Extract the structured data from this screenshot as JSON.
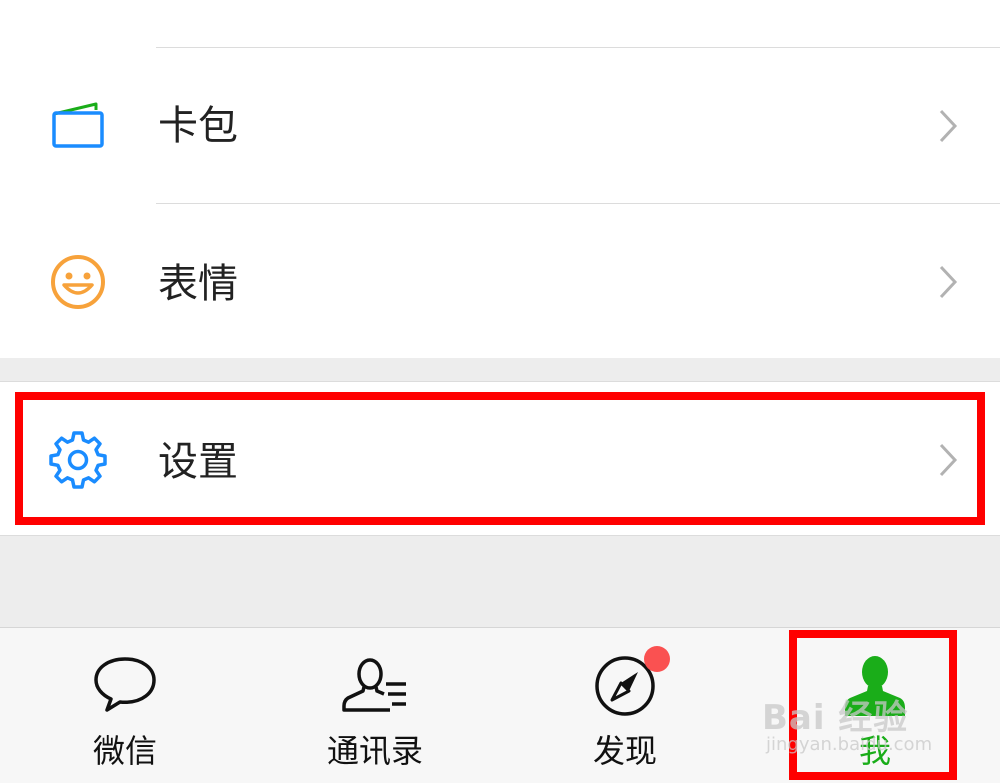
{
  "menu": {
    "items": [
      {
        "label": "卡包",
        "icon": "card-wallet-icon"
      },
      {
        "label": "表情",
        "icon": "smiley-face-icon"
      },
      {
        "label": "设置",
        "icon": "gear-icon"
      }
    ]
  },
  "tabbar": {
    "tabs": [
      {
        "label": "微信",
        "icon": "chat-bubble-icon"
      },
      {
        "label": "通讯录",
        "icon": "contacts-icon"
      },
      {
        "label": "发现",
        "icon": "compass-icon"
      },
      {
        "label": "我",
        "icon": "person-icon",
        "active": true
      }
    ]
  },
  "watermark": {
    "brand": "Bai 经验",
    "url": "jingyan.baidu.com"
  },
  "colors": {
    "accent": "#1aad19",
    "highlight": "#ff0000",
    "badge": "#fa5151",
    "gear": "#1a8cff",
    "smiley": "#f7a23b"
  }
}
